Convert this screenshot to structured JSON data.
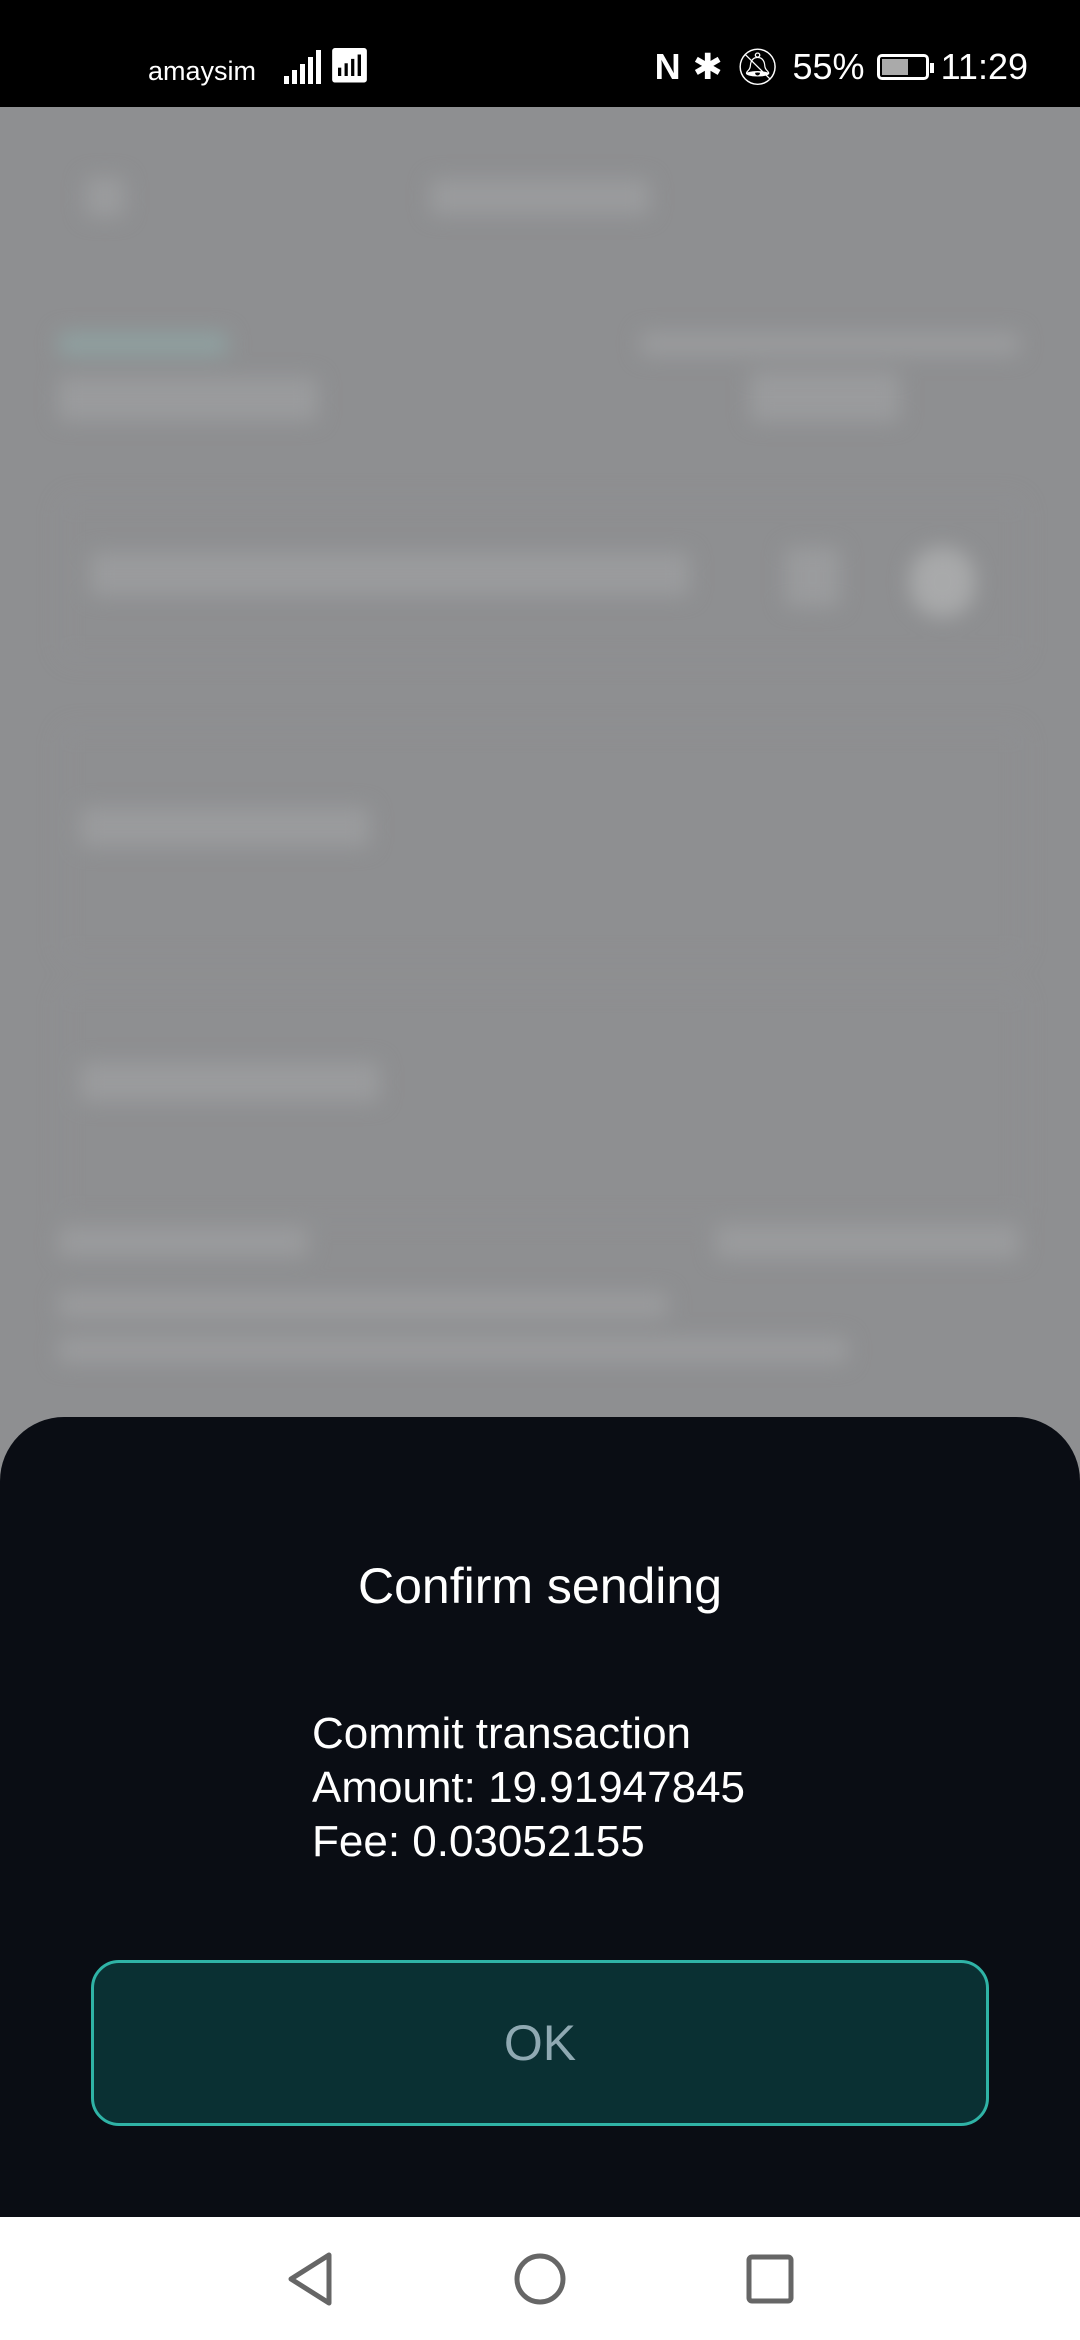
{
  "status_bar": {
    "carrier": "amaysim",
    "battery": "55%",
    "time": "11:29"
  },
  "dialog": {
    "title": "Confirm sending",
    "lines": [
      "Commit transaction",
      "Amount: 19.91947845",
      "Fee: 0.03052155"
    ],
    "ok_label": "OK",
    "accent": "#2fb3a6"
  }
}
